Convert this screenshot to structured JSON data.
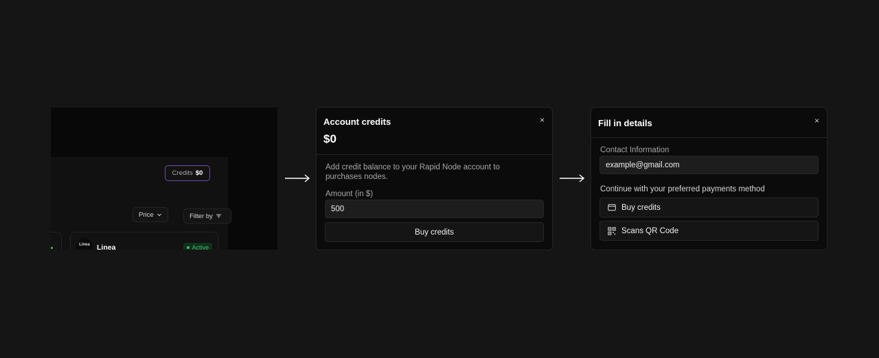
{
  "app_crop": {
    "credits_label": "Credits",
    "credits_value": "$0",
    "price_button": "Price",
    "filter_button": "Filter by",
    "node_name": "Linea",
    "node_logo_text": "Linea",
    "node_status": "Active"
  },
  "credits_modal": {
    "title": "Account credits",
    "balance": "$0",
    "close": "×",
    "description": "Add credit balance to your Rapid Node account to purchases nodes.",
    "amount_label": "Amount (in $)",
    "amount_value": "500",
    "buy_button": "Buy credits"
  },
  "details_modal": {
    "title": "Fill in details",
    "close": "×",
    "contact_label": "Contact Information",
    "contact_value": "example@gmail.com",
    "payment_label": "Continue with your preferred payments method",
    "option_buy": "Buy credits",
    "option_buy_icon": "wallet-icon",
    "option_qr": "Scans QR Code",
    "option_qr_icon": "qr-code-icon"
  }
}
